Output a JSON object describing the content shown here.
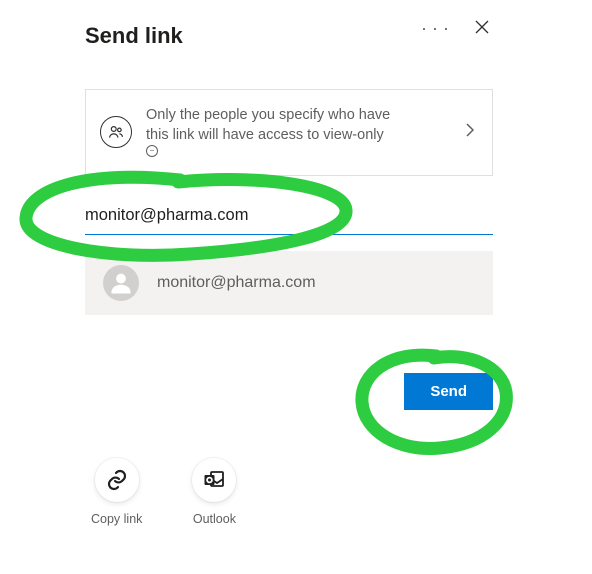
{
  "header": {
    "title": "Send link"
  },
  "permission": {
    "line1": "Only the people you specify who have",
    "line2": "this link will have access to view-only"
  },
  "email": {
    "value": "monitor@pharma.com"
  },
  "suggestion": {
    "email": "monitor@pharma.com"
  },
  "buttons": {
    "send": "Send"
  },
  "actions": {
    "copy_link": "Copy link",
    "outlook": "Outlook"
  }
}
